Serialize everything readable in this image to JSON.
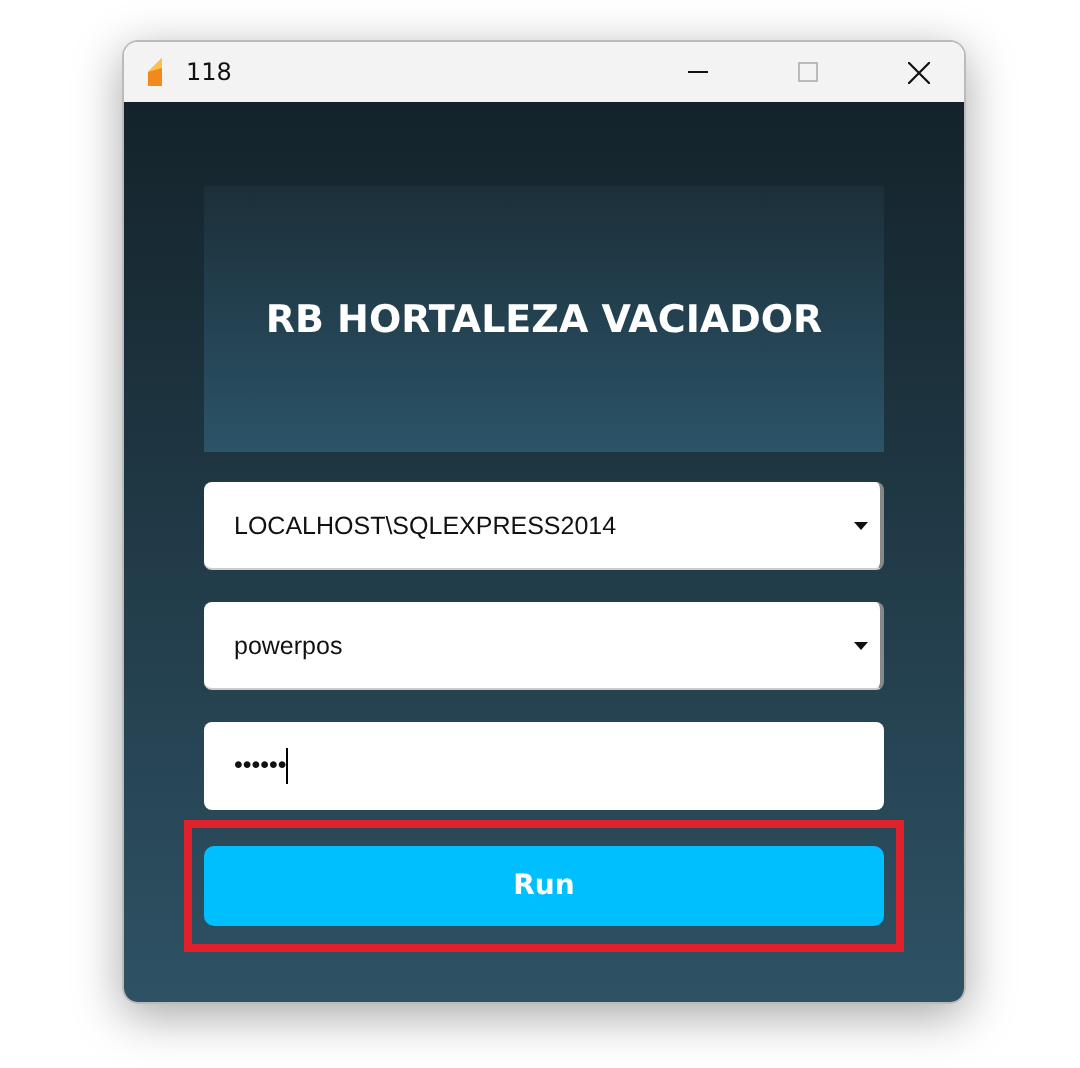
{
  "window": {
    "title": "118"
  },
  "header": {
    "title": "RB HORTALEZA VACIADOR"
  },
  "fields": [
    {
      "kind": "dropdown",
      "value": "LOCALHOST\\SQLEXPRESS2014"
    },
    {
      "kind": "dropdown",
      "value": "powerpos"
    },
    {
      "kind": "password",
      "value": "••••••",
      "focused": true
    }
  ],
  "run_button": {
    "label": "Run",
    "highlighted": true
  }
}
